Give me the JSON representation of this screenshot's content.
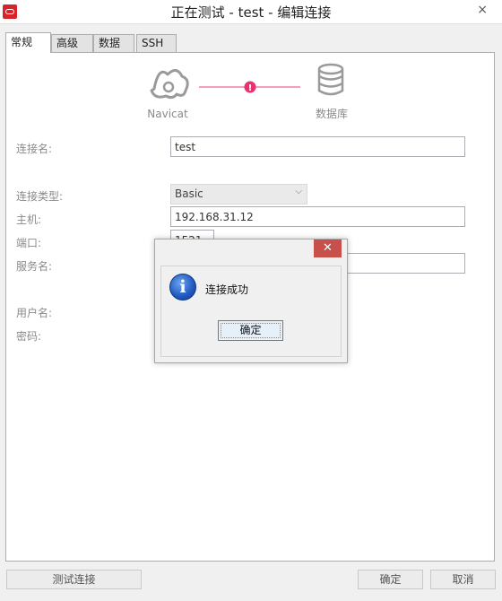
{
  "window": {
    "title": "正在测试 - test - 编辑连接",
    "close_glyph": "×"
  },
  "tabs": [
    {
      "label": "常规",
      "active": true
    },
    {
      "label": "高级",
      "active": false
    },
    {
      "label": "数据库",
      "active": false
    },
    {
      "label": "SSH",
      "active": false
    }
  ],
  "graphic": {
    "left_label": "Navicat",
    "right_label": "数据库",
    "status_glyph": "!",
    "accent_color": "#e6336f"
  },
  "form": {
    "conn_name": {
      "label": "连接名:",
      "value": "test"
    },
    "conn_type": {
      "label": "连接类型:",
      "value": "Basic"
    },
    "host": {
      "label": "主机:",
      "value": "192.168.31.12"
    },
    "port": {
      "label": "端口:",
      "value": "1521"
    },
    "service": {
      "label": "服务名:",
      "value": ""
    },
    "username": {
      "label": "用户名:"
    },
    "password": {
      "label": "密码:"
    }
  },
  "buttons": {
    "test": "测试连接",
    "ok": "确定",
    "cancel": "取消"
  },
  "dialog": {
    "message": "连接成功",
    "ok": "确定",
    "close_glyph": "✕",
    "icon": "info-icon"
  }
}
